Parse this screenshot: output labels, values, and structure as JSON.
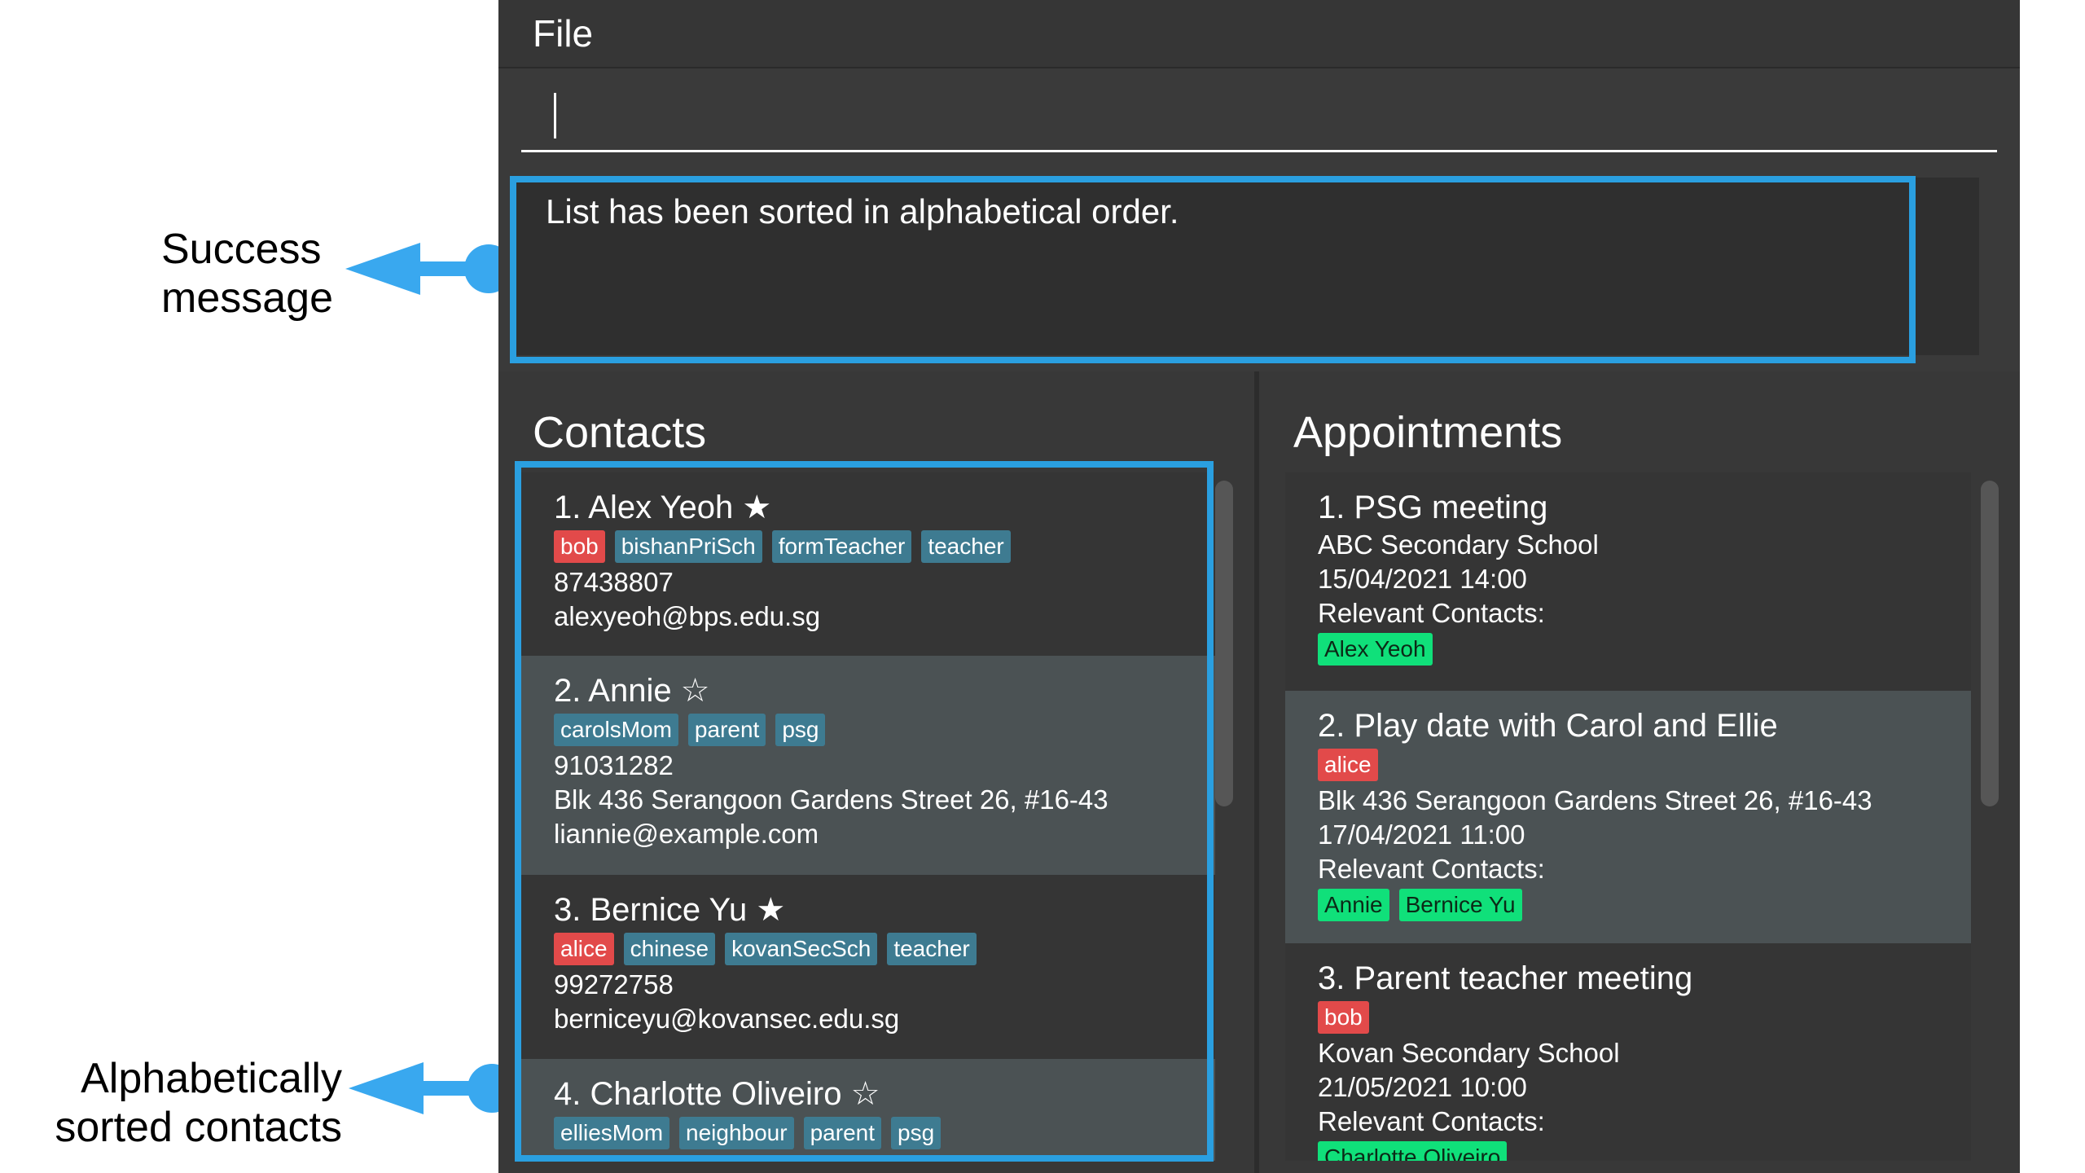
{
  "annotations": {
    "success": "Success\nmessage",
    "sorted": "Alphabetically\nsorted contacts"
  },
  "menu": {
    "file": "File"
  },
  "command": {
    "value": ""
  },
  "result": {
    "message": "List has been sorted in alphabetical order."
  },
  "contacts": {
    "title": "Contacts",
    "items": [
      {
        "heading": "1.  Alex Yeoh ★",
        "tags": [
          {
            "t": "bob",
            "c": "red"
          },
          {
            "t": "bishanPriSch",
            "c": "blue"
          },
          {
            "t": "formTeacher",
            "c": "blue"
          },
          {
            "t": "teacher",
            "c": "blue"
          }
        ],
        "lines": [
          "87438807",
          "alexyeoh@bps.edu.sg"
        ]
      },
      {
        "heading": "2.  Annie ☆",
        "tags": [
          {
            "t": "carolsMom",
            "c": "blue"
          },
          {
            "t": "parent",
            "c": "blue"
          },
          {
            "t": "psg",
            "c": "blue"
          }
        ],
        "lines": [
          "91031282",
          "Blk 436 Serangoon Gardens Street 26, #16-43",
          "liannie@example.com"
        ]
      },
      {
        "heading": "3.  Bernice Yu ★",
        "tags": [
          {
            "t": "alice",
            "c": "red"
          },
          {
            "t": "chinese",
            "c": "blue"
          },
          {
            "t": "kovanSecSch",
            "c": "blue"
          },
          {
            "t": "teacher",
            "c": "blue"
          }
        ],
        "lines": [
          "99272758",
          "berniceyu@kovansec.edu.sg"
        ]
      },
      {
        "heading": "4.  Charlotte Oliveiro ☆",
        "tags": [
          {
            "t": "elliesMom",
            "c": "blue"
          },
          {
            "t": "neighbour",
            "c": "blue"
          },
          {
            "t": "parent",
            "c": "blue"
          },
          {
            "t": "psg",
            "c": "blue"
          }
        ],
        "lines": []
      }
    ]
  },
  "appointments": {
    "title": "Appointments",
    "items": [
      {
        "heading": "1.  PSG meeting",
        "pre": [
          "ABC Secondary School",
          "15/04/2021 14:00",
          "Relevant Contacts:"
        ],
        "contacts": [
          "Alex Yeoh"
        ]
      },
      {
        "heading": "2.  Play date with Carol and Ellie",
        "tags": [
          {
            "t": "alice",
            "c": "red"
          }
        ],
        "pre": [
          "Blk 436 Serangoon Gardens Street 26, #16-43",
          "17/04/2021 11:00",
          "Relevant Contacts:"
        ],
        "contacts": [
          "Annie",
          "Bernice Yu"
        ]
      },
      {
        "heading": "3.  Parent teacher meeting",
        "tags": [
          {
            "t": "bob",
            "c": "red"
          }
        ],
        "pre": [
          "Kovan Secondary School",
          "21/05/2021 10:00",
          "Relevant Contacts:"
        ],
        "contacts": [
          "Charlotte Oliveiro"
        ]
      }
    ]
  },
  "colors": {
    "highlight": "#2a9fe0",
    "tag_blue": "#3e7b91",
    "tag_red": "#e24a4a",
    "tag_green": "#10e07a"
  }
}
